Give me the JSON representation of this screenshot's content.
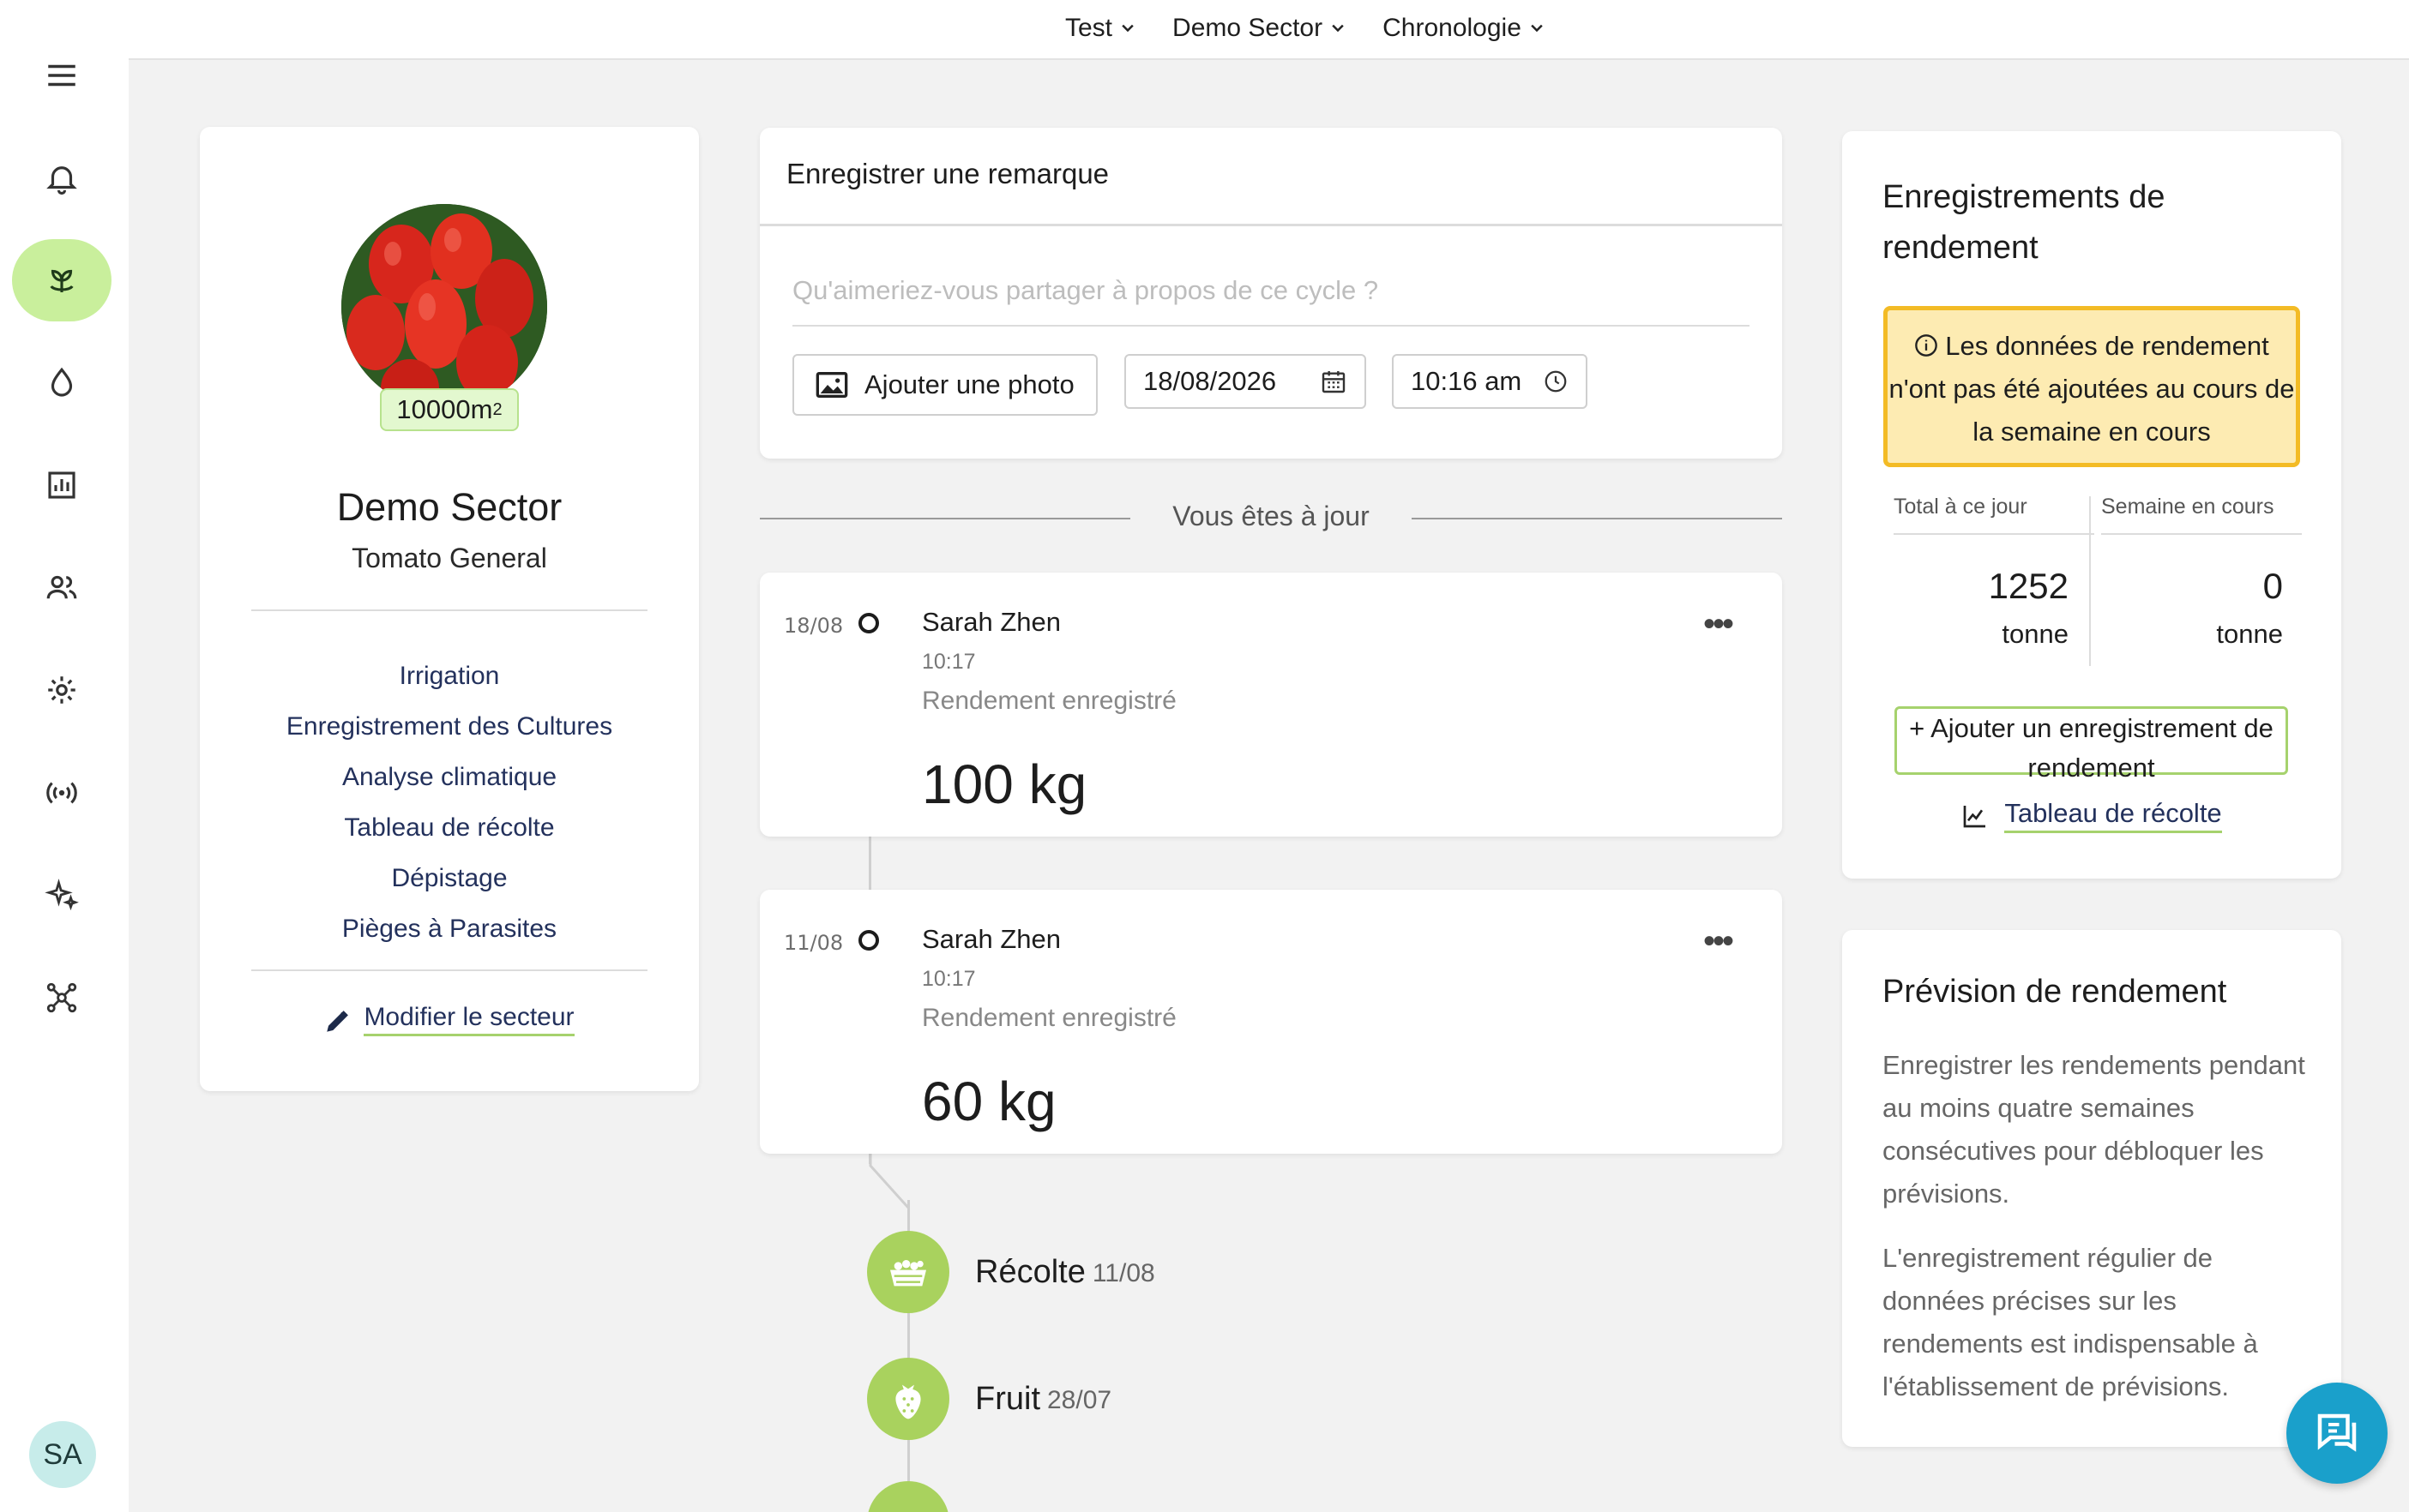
{
  "topnav": {
    "farm": "Test",
    "sector": "Demo Sector",
    "view": "Chronologie"
  },
  "sidebar": {
    "icons": [
      "menu-icon",
      "bell-icon",
      "plant-icon",
      "water-drop-icon",
      "chart-icon",
      "people-icon",
      "gear-icon",
      "sensor-icon",
      "sparkle-icon",
      "network-icon"
    ],
    "avatar_initials": "SA"
  },
  "sector": {
    "area_value": "10000m",
    "area_exp": "2",
    "name": "Demo Sector",
    "crop": "Tomato General",
    "links": [
      "Irrigation",
      "Enregistrement des Cultures",
      "Analyse climatique",
      "Tableau de récolte",
      "Dépistage",
      "Pièges à Parasites"
    ],
    "edit_label": "Modifier le secteur"
  },
  "remark": {
    "title": "Enregistrer une remarque",
    "placeholder": "Qu'aimeriez-vous partager à propos de ce cycle ?",
    "photo_button": "Ajouter une photo",
    "date": "18/08/2026",
    "time": "10:16 am"
  },
  "uptodate": "Vous êtes à jour",
  "entries": [
    {
      "date": "18/08",
      "user": "Sarah Zhen",
      "time": "10:17",
      "type": "Rendement enregistré",
      "value": "100 kg"
    },
    {
      "date": "11/08",
      "user": "Sarah Zhen",
      "time": "10:17",
      "type": "Rendement enregistré",
      "value": "60 kg"
    }
  ],
  "stages": [
    {
      "name": "Récolte",
      "date": "11/08",
      "icon": "harvest-basket-icon"
    },
    {
      "name": "Fruit",
      "date": "28/07",
      "icon": "strawberry-icon"
    }
  ],
  "yield": {
    "title": "Enregistrements de rendement",
    "warning": "Les données de rendement n'ont pas été ajoutées au cours de la semaine en cours",
    "total_label": "Total à ce jour",
    "week_label": "Semaine en cours",
    "total_value": "1252",
    "week_value": "0",
    "unit": "tonne",
    "add_button": "+ Ajouter un enregistrement de rendement",
    "harvest_link": "Tableau de récolte"
  },
  "forecast": {
    "title": "Prévision de rendement",
    "p1": "Enregistrer les rendements pendant au moins quatre semaines consécutives pour débloquer les prévisions.",
    "p2": "L'enregistrement régulier de données précises sur les rendements est indispensable à l'établissement de prévisions."
  },
  "colors": {
    "accent_green": "#a6d26d",
    "active_nav": "#c9ef9c",
    "warning_bg": "#fdebb2",
    "warning_border": "#f3bb25",
    "chat": "#1aa0cb"
  }
}
